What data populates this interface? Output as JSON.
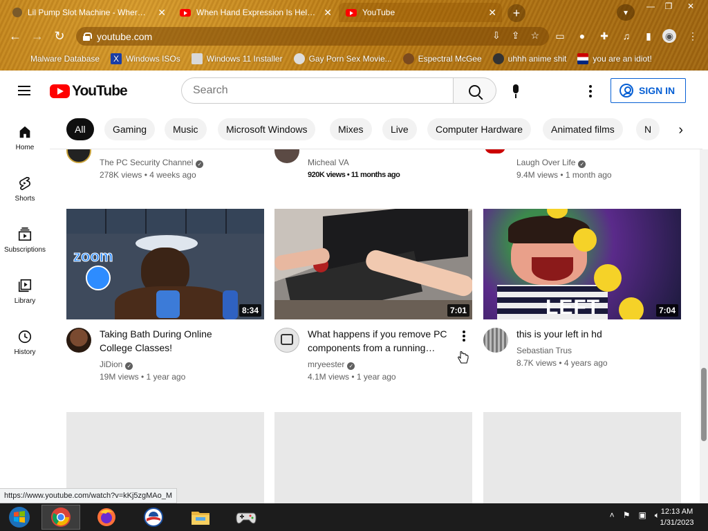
{
  "browser": {
    "tabs": [
      {
        "title": "Lil Pump Slot Machine - Where Is",
        "favicon": "generic-icon"
      },
      {
        "title": "When Hand Expression Is Helpful",
        "favicon": "youtube-icon"
      },
      {
        "title": "YouTube",
        "favicon": "youtube-icon"
      }
    ],
    "new_tab": "+",
    "address": "youtube.com",
    "window_controls": {
      "minimize": "—",
      "maximize": "❐",
      "close": "✕"
    },
    "bookmarks": [
      "Malware Database",
      "Windows ISOs",
      "Windows 11 Installer",
      "Gay Porn Sex Movie...",
      "Espectral McGee",
      "uhhh anime shit",
      "you are an idiot!"
    ],
    "theme_color": "#b07318"
  },
  "youtube": {
    "logo_text": "YouTube",
    "search_placeholder": "Search",
    "sign_in": "SIGN IN",
    "chips": [
      "All",
      "Gaming",
      "Music",
      "Microsoft Windows",
      "Mixes",
      "Live",
      "Computer Hardware",
      "Animated films",
      "N"
    ],
    "sidebar": [
      {
        "label": "Home",
        "icon": "home-icon"
      },
      {
        "label": "Shorts",
        "icon": "shorts-icon"
      },
      {
        "label": "Subscriptions",
        "icon": "subscriptions-icon"
      },
      {
        "label": "Library",
        "icon": "library-icon"
      },
      {
        "label": "History",
        "icon": "history-icon"
      }
    ],
    "top_row": [
      {
        "channel": "The PC Security Channel",
        "verified": true,
        "meta": "278K views • 4 weeks ago"
      },
      {
        "channel": "Micheal VA",
        "verified": false,
        "meta": "920K views • 11 months ago"
      },
      {
        "channel": "Laugh Over Life",
        "verified": true,
        "meta": "9.4M views • 1 month ago"
      }
    ],
    "videos": [
      {
        "title": "Taking Bath During Online College Classes!",
        "channel": "JiDion",
        "verified": true,
        "meta": "19M views • 1 year ago",
        "duration": "8:34"
      },
      {
        "title": "What happens if you remove PC components from a running…",
        "channel": "mryeester",
        "verified": true,
        "meta": "4.1M views • 1 year ago",
        "duration": "7:01"
      },
      {
        "title": "this is your left in hd",
        "channel": "Sebastian Trus",
        "verified": false,
        "meta": "8.7K views • 4 years ago",
        "duration": "7:04"
      }
    ],
    "status_url": "https://www.youtube.com/watch?v=kKj5zgMAo_M"
  },
  "taskbar": {
    "time": "12:13 AM",
    "date": "1/31/2023"
  }
}
